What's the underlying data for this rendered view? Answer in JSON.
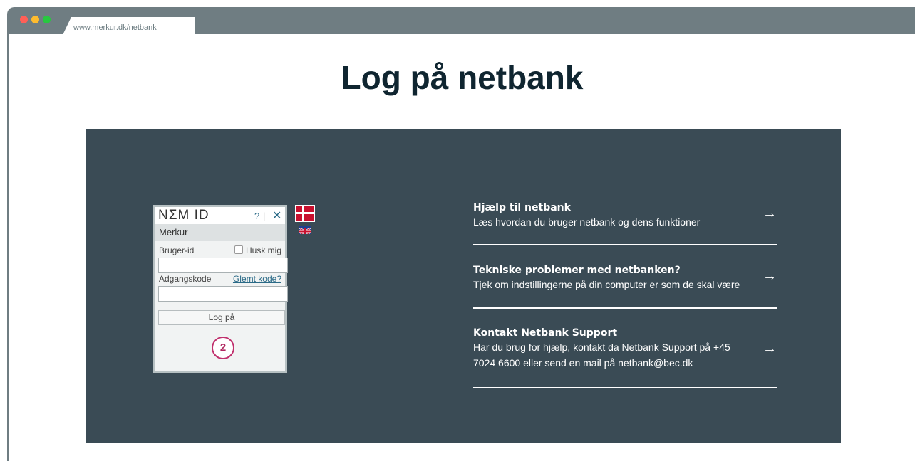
{
  "browser": {
    "url": "www.merkur.dk/netbank"
  },
  "page": {
    "title": "Log på netbank"
  },
  "nemid": {
    "logo": "NΣM ID",
    "help": "?",
    "separator": "|",
    "close": "✕",
    "bank_name": "Merkur",
    "user_label": "Bruger-id",
    "remember_label": "Husk mig",
    "user_value": "",
    "password_label": "Adgangskode",
    "forgot_link": "Glemt kode?",
    "password_value": "",
    "login_button": "Log på",
    "step_badge": "2"
  },
  "help_items": [
    {
      "heading": "Hjælp til netbank",
      "description": "Læs hvordan du bruger netbank og dens funktioner",
      "arrow": "→"
    },
    {
      "heading": "Tekniske problemer med netbanken?",
      "description": "Tjek om indstillingerne på din computer er som de skal være",
      "arrow": "→"
    },
    {
      "heading": "Kontakt Netbank Support",
      "description": "Har du brug for hjælp, kontakt da Netbank Support på +45 7024 6600 eller send en mail på netbank@bec.dk",
      "arrow": "→"
    }
  ],
  "colors": {
    "panel": "#3a4b55",
    "title": "#0f2530",
    "badge": "#c0306d",
    "link": "#2a6a87"
  }
}
